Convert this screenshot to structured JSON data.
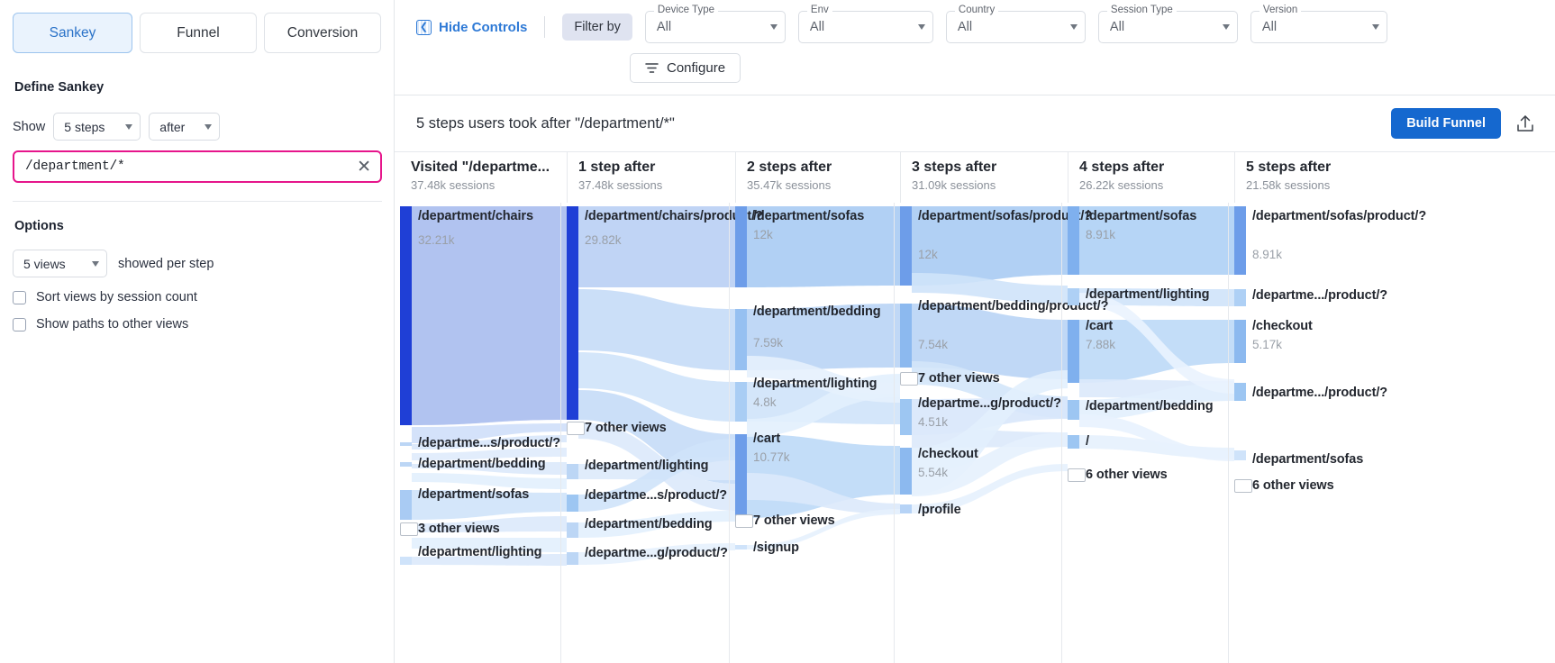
{
  "left_panel": {
    "tabs": [
      {
        "label": "Sankey",
        "active": true
      },
      {
        "label": "Funnel",
        "active": false
      },
      {
        "label": "Conversion",
        "active": false
      }
    ],
    "define_title": "Define Sankey",
    "show_label": "Show",
    "steps_value": "5 steps",
    "after_value": "after",
    "query_value": "/department/*",
    "clear_icon": "close-icon",
    "options_title": "Options",
    "views_value": "5 views",
    "views_caption": "showed per step",
    "checkboxes": [
      {
        "label": "Sort views by session count",
        "checked": false
      },
      {
        "label": "Show paths to other views",
        "checked": false
      }
    ]
  },
  "toolbar": {
    "hide_controls_label": "Hide Controls",
    "filter_by_label": "Filter by",
    "configure_label": "Configure",
    "filters": [
      {
        "legend": "Device Type",
        "value": "All"
      },
      {
        "legend": "Env",
        "value": "All"
      },
      {
        "legend": "Country",
        "value": "All"
      },
      {
        "legend": "Session Type",
        "value": "All"
      },
      {
        "legend": "Version",
        "value": "All"
      }
    ]
  },
  "chart_header": {
    "title": "5 steps users took after \"/department/*\"",
    "build_funnel_label": "Build Funnel",
    "export_icon": "export-upload-icon"
  },
  "chart_data": {
    "type": "sankey",
    "title": "5 steps users took after \"/department/*\"",
    "accent_color": "#1f3fd6",
    "columns": [
      {
        "header": "Visited \"/departme...",
        "sessions": "37.48k sessions",
        "nodes": [
          {
            "label": "/department/chairs",
            "value": "32.21k",
            "show_value": true
          },
          {
            "label": "/departme...s/product/?",
            "value": "",
            "show_value": false
          },
          {
            "label": "/department/bedding",
            "value": "",
            "show_value": false
          },
          {
            "label": "/department/sofas",
            "value": "",
            "show_value": false
          },
          {
            "label": "3 other views",
            "value": "",
            "show_value": false
          },
          {
            "label": "/department/lighting",
            "value": "",
            "show_value": false
          }
        ]
      },
      {
        "header": "1 step after",
        "sessions": "37.48k sessions",
        "nodes": [
          {
            "label": "/department/chairs/product/?",
            "value": "29.82k",
            "show_value": true
          },
          {
            "label": "7 other views",
            "value": "",
            "show_value": false
          },
          {
            "label": "/department/lighting",
            "value": "",
            "show_value": false
          },
          {
            "label": "/departme...s/product/?",
            "value": "",
            "show_value": false
          },
          {
            "label": "/department/bedding",
            "value": "",
            "show_value": false
          },
          {
            "label": "/departme...g/product/?",
            "value": "",
            "show_value": false
          }
        ]
      },
      {
        "header": "2 steps after",
        "sessions": "35.47k sessions",
        "nodes": [
          {
            "label": "/department/sofas",
            "value": "12k",
            "show_value": true
          },
          {
            "label": "/department/bedding",
            "value": "7.59k",
            "show_value": true
          },
          {
            "label": "/department/lighting",
            "value": "4.8k",
            "show_value": true
          },
          {
            "label": "/cart",
            "value": "10.77k",
            "show_value": true
          },
          {
            "label": "7 other views",
            "value": "",
            "show_value": false
          },
          {
            "label": "/signup",
            "value": "",
            "show_value": false
          }
        ]
      },
      {
        "header": "3 steps after",
        "sessions": "31.09k sessions",
        "nodes": [
          {
            "label": "/department/sofas/product/?",
            "value": "12k",
            "show_value": true
          },
          {
            "label": "/department/bedding/product/?",
            "value": "7.54k",
            "show_value": true
          },
          {
            "label": "7 other views",
            "value": "",
            "show_value": false
          },
          {
            "label": "/departme...g/product/?",
            "value": "4.51k",
            "show_value": true
          },
          {
            "label": "/checkout",
            "value": "5.54k",
            "show_value": true
          },
          {
            "label": "/profile",
            "value": "",
            "show_value": false
          }
        ]
      },
      {
        "header": "4 steps after",
        "sessions": "26.22k sessions",
        "nodes": [
          {
            "label": "/department/sofas",
            "value": "8.91k",
            "show_value": true
          },
          {
            "label": "/department/lighting",
            "value": "",
            "show_value": false
          },
          {
            "label": "/cart",
            "value": "7.88k",
            "show_value": true
          },
          {
            "label": "/department/bedding",
            "value": "",
            "show_value": false
          },
          {
            "label": "/",
            "value": "",
            "show_value": false
          },
          {
            "label": "6 other views",
            "value": "",
            "show_value": false
          }
        ]
      },
      {
        "header": "5 steps after",
        "sessions": "21.58k sessions",
        "nodes": [
          {
            "label": "/department/sofas/product/?",
            "value": "8.91k",
            "show_value": true
          },
          {
            "label": "/departme.../product/?",
            "value": "",
            "show_value": false
          },
          {
            "label": "/checkout",
            "value": "5.17k",
            "show_value": true
          },
          {
            "label": "/departme.../product/?",
            "value": "",
            "show_value": false
          },
          {
            "label": "/department/sofas",
            "value": "",
            "show_value": false
          },
          {
            "label": "6 other views",
            "value": "",
            "show_value": false
          }
        ]
      }
    ]
  }
}
